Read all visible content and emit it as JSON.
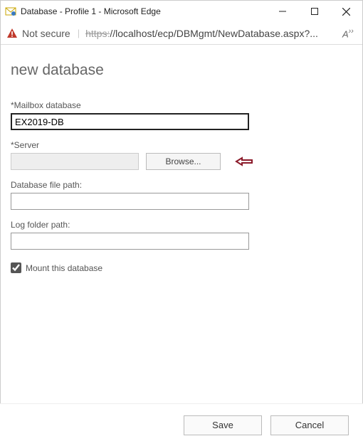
{
  "window": {
    "title": "Database - Profile 1 - Microsoft Edge"
  },
  "address": {
    "security_text": "Not secure",
    "protocol": "https:",
    "url_rest": "//localhost/ecp/DBMgmt/NewDatabase.aspx?..."
  },
  "page": {
    "heading": "new database",
    "mailbox_db_label": "*Mailbox database",
    "mailbox_db_value": "EX2019-DB",
    "server_label": "*Server",
    "server_value": "",
    "browse_label": "Browse...",
    "file_path_label": "Database file path:",
    "file_path_value": "",
    "log_path_label": "Log folder path:",
    "log_path_value": "",
    "mount_label": "Mount this database"
  },
  "footer": {
    "save_label": "Save",
    "cancel_label": "Cancel"
  }
}
